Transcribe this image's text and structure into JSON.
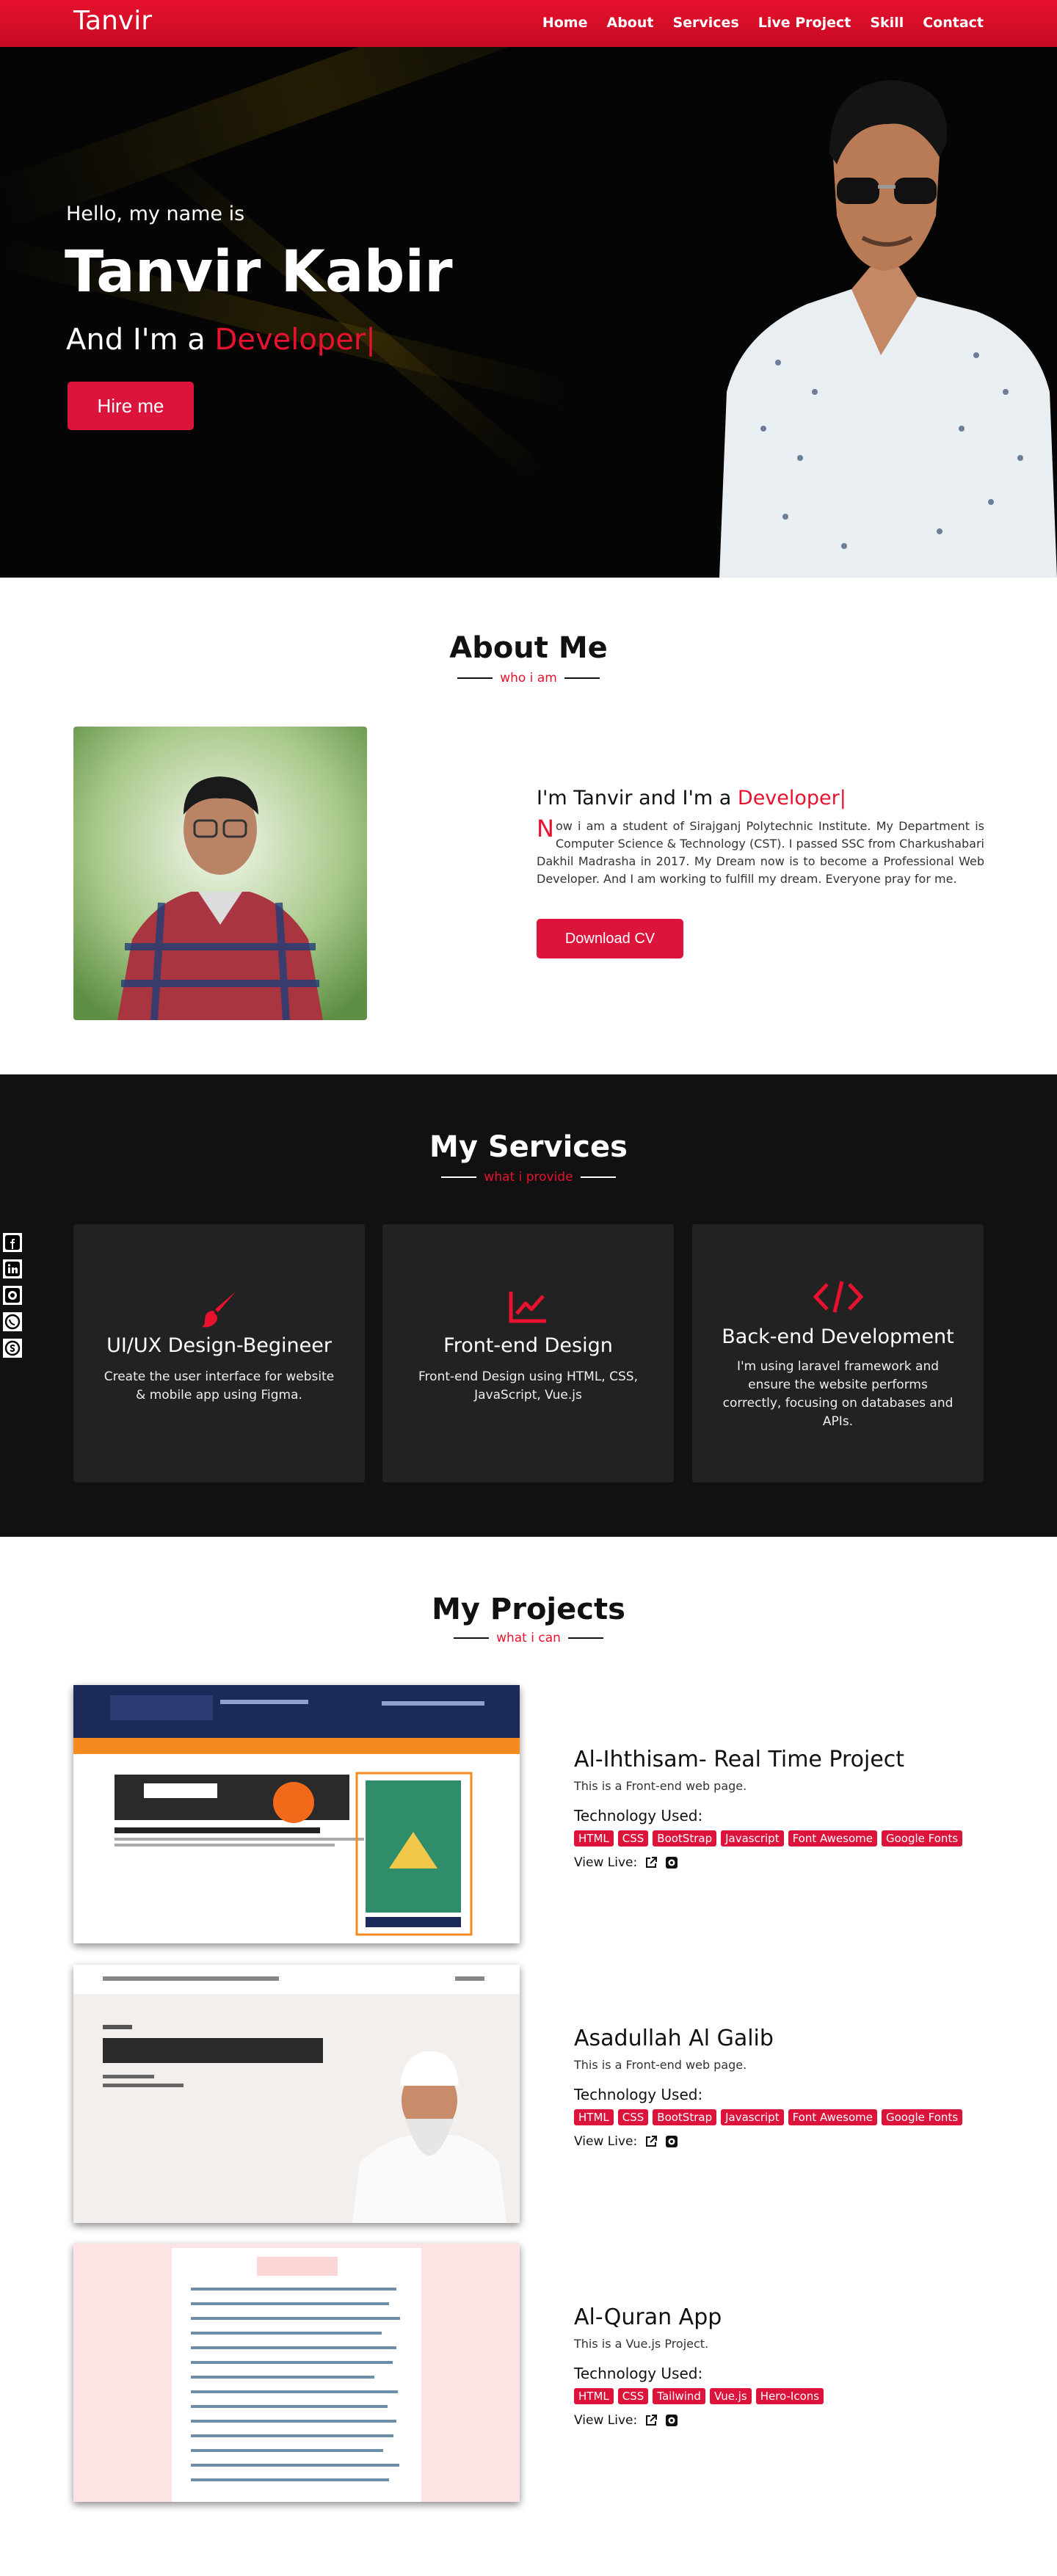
{
  "nav": {
    "brand": "Tanvir",
    "items": [
      "Home",
      "About",
      "Services",
      "Live Project",
      "Skill",
      "Contact"
    ]
  },
  "hero": {
    "greeting": "Hello, my name is",
    "name": "Tanvir Kabir",
    "role_prefix": "And I'm a",
    "role": "Developer|",
    "hire_button": "Hire me"
  },
  "about": {
    "title": "About Me",
    "subtitle": "who i am",
    "heading_prefix": "I'm Tanvir and I'm a",
    "heading_role": "Developer|",
    "text_initial": "N",
    "text": "ow i am a student of Sirajganj Polytechnic Institute. My Department is Computer Science & Technology (CST). I passed SSC from Charkushabari Dakhil Madrasha in 2017. My Dream now is to become a Professional Web Developer. And I am working to fulfill my dream. Everyone pray for me.",
    "cv_button": "Download CV"
  },
  "services": {
    "title": "My Services",
    "subtitle": "what i provide",
    "cards": [
      {
        "icon": "paintbrush-icon",
        "title": "UI/UX Design-Begineer",
        "desc": "Create the user interface for website & mobile app using Figma."
      },
      {
        "icon": "chart-line-icon",
        "title": "Front-end Design",
        "desc": "Front-end Design using HTML, CSS, JavaScript, Vue.js"
      },
      {
        "icon": "code-icon",
        "title": "Back-end Development",
        "desc": "I'm using laravel framework and ensure the website performs correctly, focusing on databases and APIs."
      }
    ]
  },
  "social": [
    "facebook-icon",
    "linkedin-icon",
    "github-icon",
    "whatsapp-icon",
    "skype-icon"
  ],
  "projects": {
    "title": "My Projects",
    "subtitle": "what i can",
    "tech_label": "Technology Used:",
    "live_label": "View Live:",
    "items": [
      {
        "title": "Al-Ihthisam- Real Time Project",
        "desc": "This is a Front-end web page.",
        "tags": [
          "HTML",
          "CSS",
          "BootStrap",
          "Javascript",
          "Font Awesome",
          "Google Fonts"
        ]
      },
      {
        "title": "Asadullah Al Galib",
        "desc": "This is a Front-end web page.",
        "tags": [
          "HTML",
          "CSS",
          "BootStrap",
          "Javascript",
          "Font Awesome",
          "Google Fonts"
        ]
      },
      {
        "title": "Al-Quran App",
        "desc": "This is a Vue.js Project.",
        "tags": [
          "HTML",
          "CSS",
          "Tailwind",
          "Vue.js",
          "Hero-Icons"
        ]
      }
    ]
  },
  "colors": {
    "accent": "#dc143c",
    "nav": "#e8112e",
    "dark": "#111111",
    "card": "#222222"
  }
}
